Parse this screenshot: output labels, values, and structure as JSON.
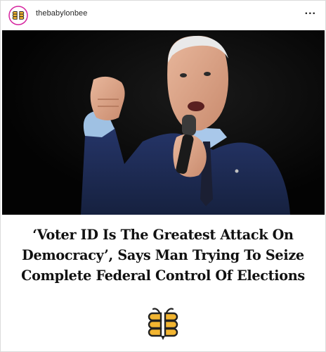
{
  "post": {
    "username": "thebabylonbee",
    "more_label": "...",
    "headline": [
      "‘Voter ID Is The Greatest Attack On",
      "Democracy’, Says Man Trying To Seize",
      "Complete Federal Control Of Elections"
    ]
  },
  "colors": {
    "brand_yellow": "#f2b531",
    "brand_dark": "#222222",
    "photo_background": "#050505",
    "suit_navy": "#1d2a52"
  },
  "icons": {
    "avatar": "babylon-bee-logo-icon",
    "more": "more-options-icon",
    "footer_logo": "babylon-bee-logo-icon"
  }
}
